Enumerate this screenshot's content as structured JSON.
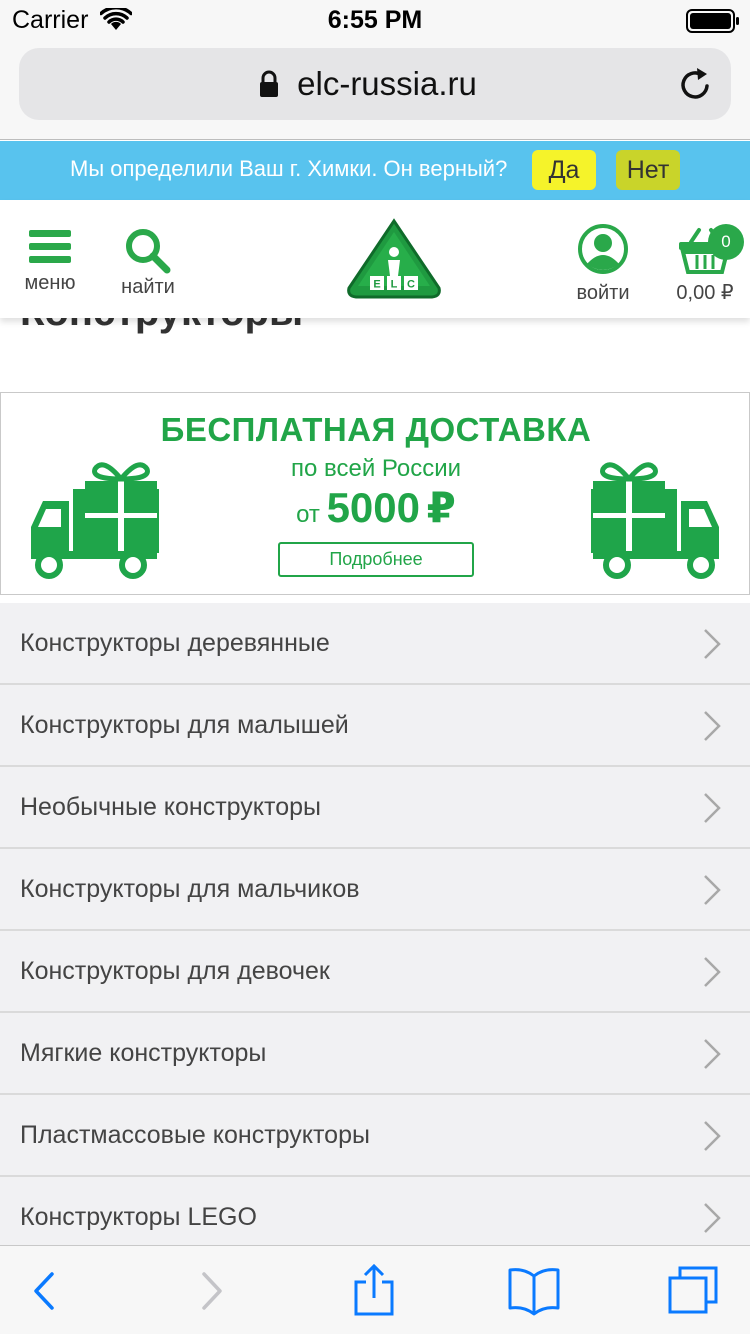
{
  "status_bar": {
    "carrier": "Carrier",
    "time": "6:55 PM"
  },
  "browser": {
    "url": "elc-russia.ru"
  },
  "city_banner": {
    "text": "Мы определили Ваш г. Химки. Он верный?",
    "yes_label": "Да",
    "no_label": "Нет",
    "yes_color": "#f5f32a",
    "no_color": "#c9d42a"
  },
  "header": {
    "menu_label": "меню",
    "search_label": "найти",
    "login_label": "войти",
    "cart_count": "0",
    "cart_total": "0,00 ₽",
    "logo_text": "ELC",
    "accent_color": "#2aa84a"
  },
  "page": {
    "title": "Конструкторы"
  },
  "promo": {
    "title": "БЕСПЛАТНАЯ ДОСТАВКА",
    "subtitle": "по всей России",
    "amount_prefix": "от",
    "amount": "5000",
    "currency": "₽",
    "button_label": "Подробнее"
  },
  "categories": [
    {
      "label": "Конструкторы деревянные"
    },
    {
      "label": "Конструкторы для малышей"
    },
    {
      "label": "Необычные конструкторы"
    },
    {
      "label": "Конструкторы для мальчиков"
    },
    {
      "label": "Конструкторы для девочек"
    },
    {
      "label": "Мягкие конструкторы"
    },
    {
      "label": "Пластмассовые конструкторы"
    },
    {
      "label": "Конструкторы LEGO"
    }
  ],
  "toolbar": {
    "icons": [
      "back-icon",
      "forward-icon",
      "share-icon",
      "bookmarks-icon",
      "tabs-icon"
    ]
  }
}
